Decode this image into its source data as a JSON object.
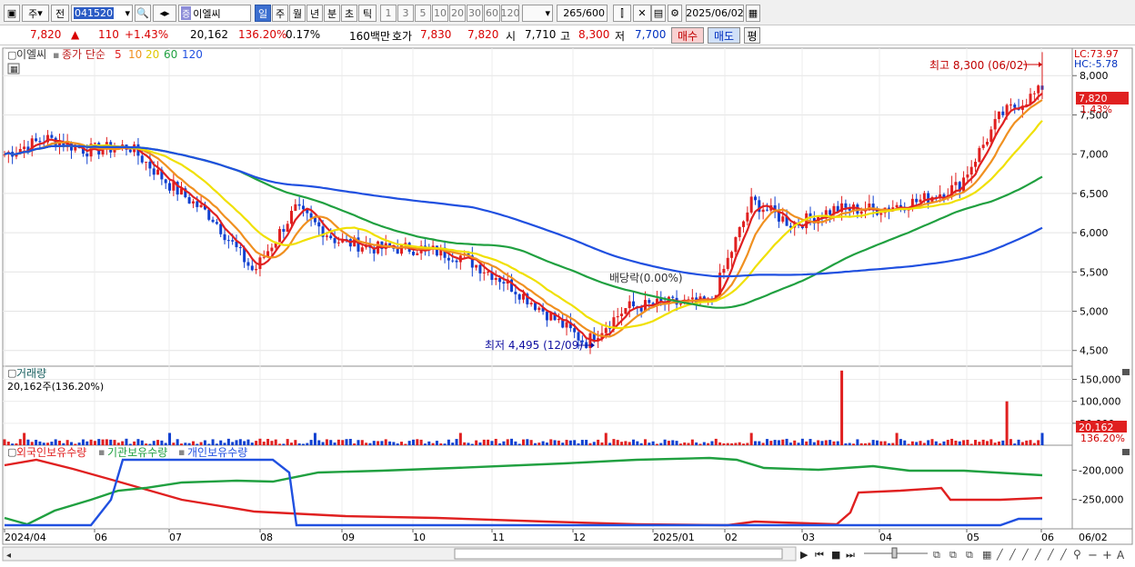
{
  "toolbar": {
    "period_type": "주",
    "prev_label": "전",
    "stock_code": "041520",
    "stock_tag": "증",
    "stock_name": "이엘씨",
    "period_buttons": [
      "일",
      "주",
      "월",
      "년",
      "분",
      "초",
      "틱"
    ],
    "active_period": "일",
    "interval_buttons": [
      "1",
      "3",
      "5",
      "10",
      "20",
      "30",
      "60",
      "120"
    ],
    "count": "265",
    "count_total": "/600",
    "date": "2025/06/02"
  },
  "quote": {
    "price": "7,820",
    "arrow": "▲",
    "change": "110",
    "change_pct": "+1.43%",
    "volume": "20,162",
    "volume_ratio": "136.20%",
    "turnover": "0.17%",
    "amount": "160백만",
    "hoga_label": "호가",
    "ask": "7,830",
    "bid": "7,820",
    "open_label": "시",
    "open": "7,710",
    "high_label": "고",
    "high": "8,300",
    "low_label": "저",
    "low": "7,700",
    "buy_label": "매수",
    "sell_label": "매도",
    "avg_label": "평"
  },
  "price_panel": {
    "name": "이엘씨",
    "ma_label": "종가 단순",
    "ma_periods": [
      "5",
      "10",
      "20",
      "60",
      "120"
    ],
    "ma_colors": [
      "#e02020",
      "#f09020",
      "#f0e000",
      "#20a040",
      "#2050e0"
    ],
    "lc": "LC:73.97",
    "hc": "HC:-5.78",
    "y_ticks": [
      "8,000",
      "7,500",
      "7,000",
      "6,500",
      "6,000",
      "5,500",
      "5,000",
      "4,500"
    ],
    "current_price": "7,820",
    "current_pct": "1.43%",
    "annotation_high": "최고 8,300 (06/02)",
    "annotation_low": "최저 4,495 (12/09)",
    "annotation_dividend": "배당락(0.00%)"
  },
  "volume_panel": {
    "title": "거래량",
    "info": "20,162주(136.20%)",
    "y_ticks": [
      "150,000",
      "100,000",
      "50,000"
    ],
    "current_volume": "20,162",
    "current_pct": "136.20%"
  },
  "holding_panel": {
    "legend": [
      "외국인보유수량",
      "기관보유수량",
      "개인보유수량"
    ],
    "legend_colors": [
      "#e02020",
      "#20a040",
      "#2050e0"
    ],
    "y_ticks": [
      "-200,000",
      "-250,000"
    ]
  },
  "x_axis": {
    "labels": [
      "2024/04",
      "06",
      "07",
      "08",
      "09",
      "10",
      "11",
      "12",
      "2025/01",
      "02",
      "03",
      "04",
      "05",
      "06"
    ],
    "right_label": "06/02"
  },
  "chart_data": {
    "type": "candlestick",
    "x": [
      "2024/04",
      "06",
      "07",
      "08",
      "09",
      "10",
      "11",
      "12",
      "2025/01",
      "02",
      "03",
      "04",
      "05",
      "06"
    ],
    "ylim": [
      4300,
      8350
    ],
    "close": [
      7000,
      7200,
      7050,
      7100,
      6600,
      6200,
      5500,
      6300,
      5900,
      5800,
      5800,
      5700,
      5400,
      5000,
      4600,
      5050,
      5100,
      5100,
      6400,
      6100,
      6300,
      6300,
      6400,
      6600,
      7500,
      7820
    ],
    "high_point": {
      "date": "06/02",
      "value": 8300
    },
    "low_point": {
      "date": "12/09",
      "value": 4495
    }
  }
}
